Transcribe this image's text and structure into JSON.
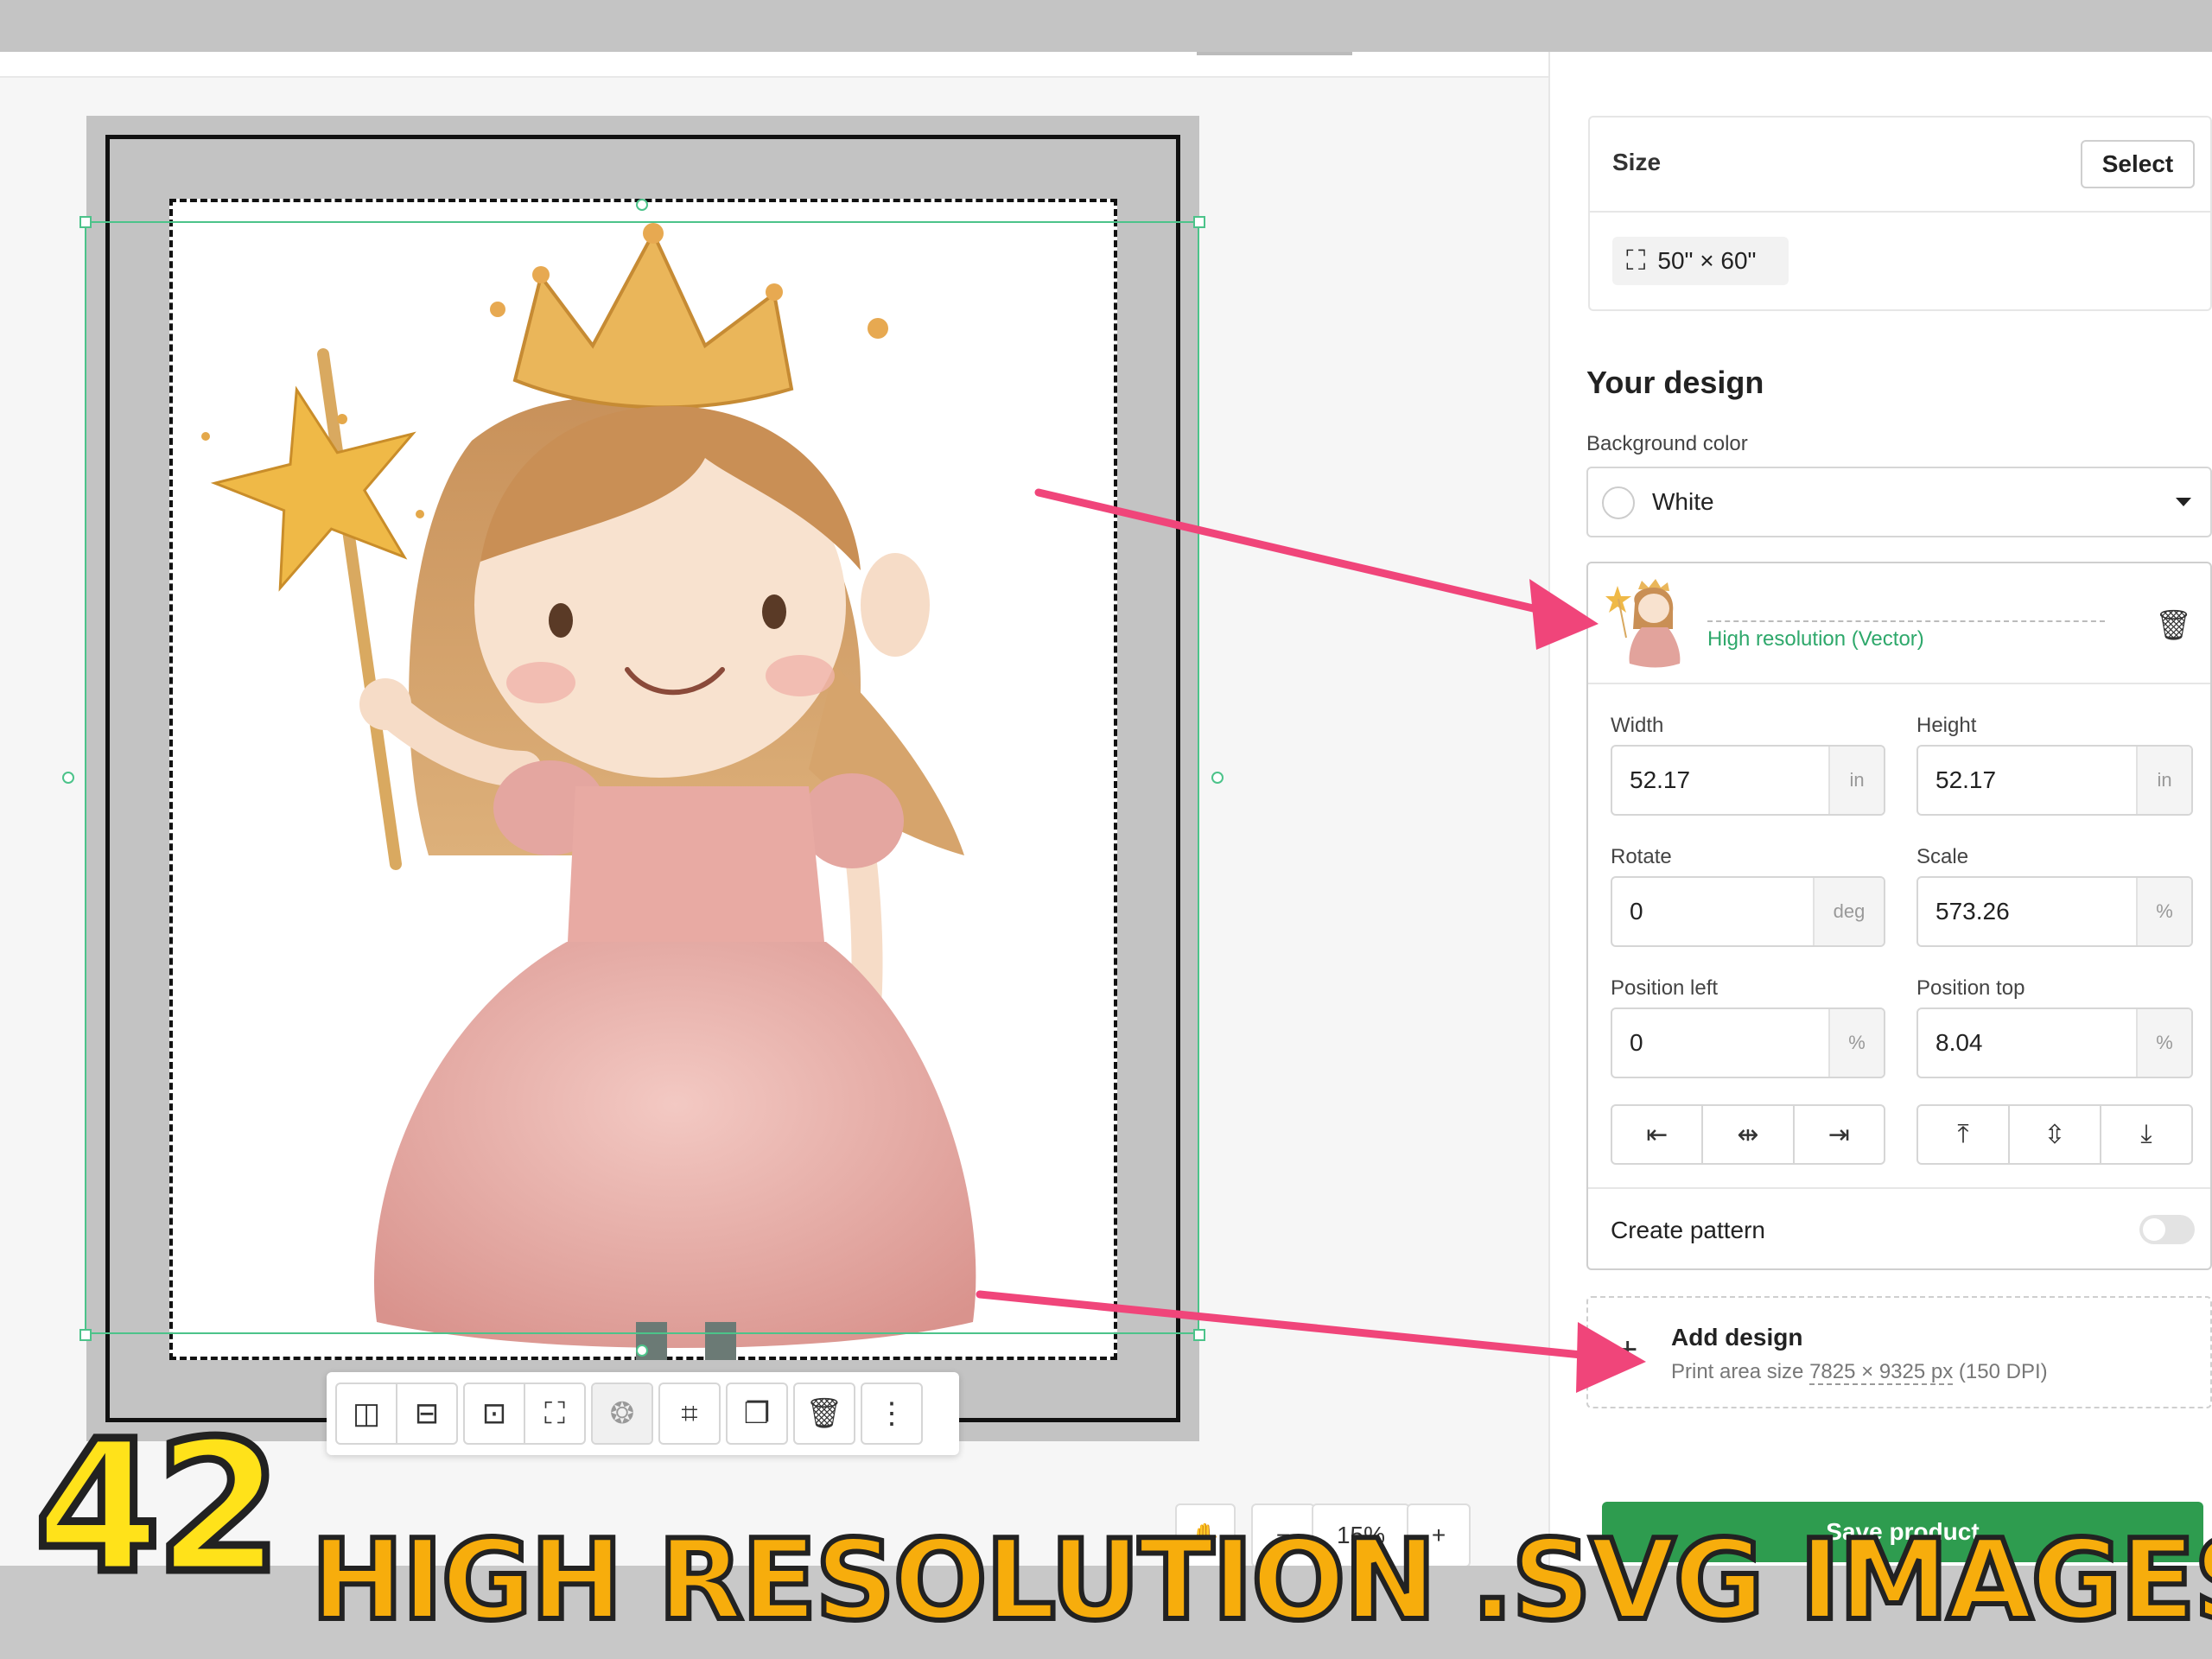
{
  "sidebar": {
    "size": {
      "label": "Size",
      "select_label": "Select",
      "value": "50\" × 60\""
    },
    "your_design": {
      "title": "Your design",
      "background_color": {
        "label": "Background color",
        "value": "White"
      },
      "layer": {
        "resolution_label": "High resolution (Vector)"
      },
      "fields": {
        "width": {
          "label": "Width",
          "value": "52.17",
          "unit": "in"
        },
        "height": {
          "label": "Height",
          "value": "52.17",
          "unit": "in"
        },
        "rotate": {
          "label": "Rotate",
          "value": "0",
          "unit": "deg"
        },
        "scale": {
          "label": "Scale",
          "value": "573.26",
          "unit": "%"
        },
        "position_left": {
          "label": "Position left",
          "value": "0",
          "unit": "%"
        },
        "position_top": {
          "label": "Position top",
          "value": "8.04",
          "unit": "%"
        }
      },
      "create_pattern": {
        "label": "Create pattern",
        "enabled": false
      }
    },
    "add_design": {
      "title": "Add design",
      "print_area_prefix": "Print area size ",
      "print_area_size": "7825 × 9325 px",
      "print_area_suffix": " (150 DPI)"
    },
    "save_label": "Save product"
  },
  "canvas": {
    "zoom_level": "15%",
    "minus": "−",
    "plus": "+"
  },
  "banner": {
    "number": "42",
    "text": "HIGH RESOLUTION .SVG IMAGES!"
  },
  "colors": {
    "accent_green": "#2e9c4f",
    "link_green": "#2ea86b",
    "arrow_pink": "#f0457a",
    "banner_yellow": "#ffe21a",
    "banner_orange": "#f7ad0c"
  },
  "icons": [
    "flip-horizontal-icon",
    "flip-vertical-icon",
    "fit-icon",
    "fill-icon",
    "remove-background-icon",
    "crop-icon",
    "duplicate-icon",
    "trash-icon",
    "more-icon",
    "hand-icon",
    "expand-icon",
    "chevron-down-icon"
  ]
}
